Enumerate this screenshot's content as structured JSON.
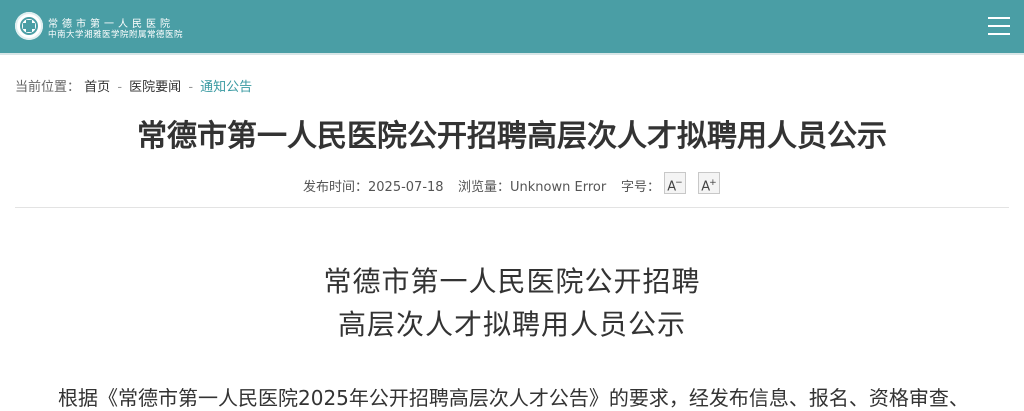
{
  "header": {
    "logo_line1": "常德市第一人民医院",
    "logo_line2": "中南大学湘雅医学院附属常德医院",
    "menu_icon": "hamburger-menu-icon",
    "color": "#4a9ea5"
  },
  "breadcrumb": {
    "label": "当前位置：",
    "items": [
      "首页",
      "医院要闻",
      "通知公告"
    ],
    "separator": "-"
  },
  "article": {
    "title": "常德市第一人民医院公开招聘高层次人才拟聘用人员公示",
    "publish_label": "发布时间：",
    "publish_date": "2025-07-18",
    "views_label": "浏览量：",
    "views_value": "Unknown Error",
    "font_size_label": "字号：",
    "font_decrease": "A",
    "font_increase": "A",
    "subtitle_line1": "常德市第一人民医院公开招聘",
    "subtitle_line2": "高层次人才拟聘用人员公示",
    "paragraph_start": "根据《常德市第一人民医院2025年公开招聘高层次人才公告》的要求，经发布信息、报名、资格审查、"
  }
}
